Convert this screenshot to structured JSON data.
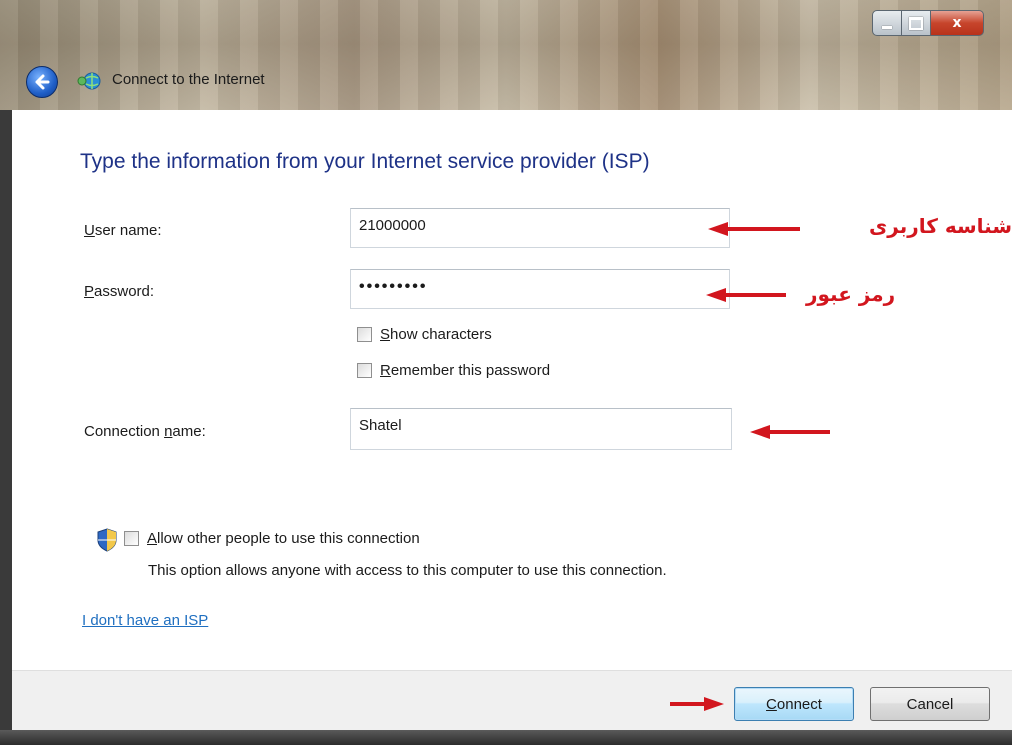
{
  "window": {
    "title": "Connect to the Internet",
    "colors": {
      "heading": "#1e3287",
      "link": "#1f6fc0",
      "annotation": "#d2161e",
      "close_button": "#c7452c"
    }
  },
  "titlebar": {
    "back_icon": "back-arrow-icon",
    "network_icon": "network-globe-icon",
    "minimize_icon": "minimize-icon",
    "maximize_icon": "maximize-icon",
    "close_label": "x"
  },
  "form": {
    "heading": "Type the information from your Internet service provider (ISP)",
    "username": {
      "label_underlined": "U",
      "label_rest": "ser name:",
      "value": "21000000"
    },
    "password": {
      "label_underlined": "P",
      "label_rest": "assword:",
      "value": "•••••••••"
    },
    "show_characters": {
      "underlined": "S",
      "rest": "how characters",
      "checked": false
    },
    "remember_password": {
      "underlined": "R",
      "rest": "emember this password",
      "checked": false
    },
    "connection_name": {
      "label_start": "Connection ",
      "label_underlined": "n",
      "label_rest": "ame:",
      "value": "Shatel"
    },
    "allow_others": {
      "underlined": "A",
      "rest": "llow other people to use this connection",
      "checked": false,
      "icon": "uac-shield-icon"
    },
    "allow_others_description": "This option allows anyone with access to this computer to use this connection.",
    "no_isp_link": "I don't have an ISP"
  },
  "annotations": {
    "username_note": "شناسه کاربری",
    "password_note": "رمز عبور"
  },
  "buttons": {
    "connect": {
      "underlined": "C",
      "rest": "onnect"
    },
    "cancel": "Cancel"
  }
}
